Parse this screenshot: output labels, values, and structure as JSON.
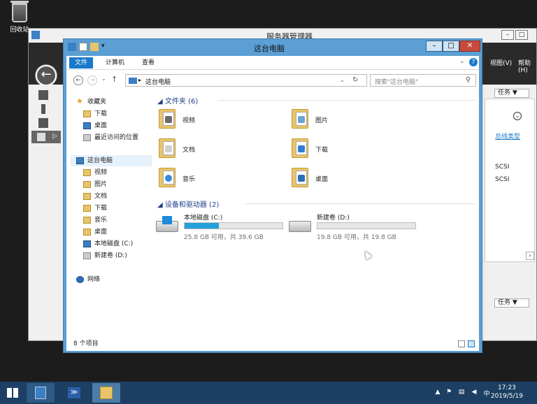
{
  "desktop": {
    "recycle_bin_label": "回收站"
  },
  "server_manager": {
    "title": "服务器管理器",
    "menu_view": "视图(V)",
    "menu_help": "帮助(H)",
    "tasks_label": "任务",
    "tasks_label_bottom": "任务",
    "link_text": "总线类型",
    "row1": "SCSI",
    "row2": "SCSI"
  },
  "explorer": {
    "title": "这台电脑",
    "ribbon_tabs": [
      "文件",
      "计算机",
      "查看"
    ],
    "address": "这台电脑",
    "search_placeholder": "搜索\"这台电脑\"",
    "nav": {
      "favorites": "收藏夹",
      "fav_items": [
        "下载",
        "桌面",
        "最近访问的位置"
      ],
      "this_pc": "这台电脑",
      "pc_items": [
        "视频",
        "图片",
        "文档",
        "下载",
        "音乐",
        "桌面",
        "本地磁盘 (C:)",
        "新建卷 (D:)"
      ],
      "network": "网络"
    },
    "folders_header": "文件夹 (6)",
    "folders": [
      "视频",
      "图片",
      "文档",
      "下载",
      "音乐",
      "桌面"
    ],
    "drives_header": "设备和驱动器 (2)",
    "drives": [
      {
        "name": "本地磁盘 (C:)",
        "free_text": "25.8 GB 可用，共 39.6 GB",
        "used_fraction": 0.35
      },
      {
        "name": "新建卷 (D:)",
        "free_text": "19.8 GB 可用，共 19.8 GB",
        "used_fraction": 0.0
      }
    ],
    "status": "8 个项目"
  },
  "taskbar": {
    "time": "17:23",
    "date": "2019/5/19"
  },
  "colors": {
    "accent": "#1979ca",
    "window_frame": "#5b9fd4",
    "close_button": "#c74b3c",
    "taskbar": "#1c3f63",
    "drive_fill": "#26a0da"
  }
}
